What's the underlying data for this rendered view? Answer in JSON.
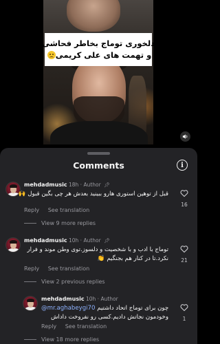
{
  "video": {
    "caption_line1": "دلخوری توماج بخاطر فحاشی",
    "caption_line2": "و تهمت های علی کریمی",
    "volume_icon": "speaker-icon"
  },
  "sheet": {
    "title": "Comments",
    "info_icon": "info-icon"
  },
  "comments": [
    {
      "username": "mehdadmusic",
      "time": "18h",
      "role": "Author",
      "text": "قبل از توهین استوری هارو ببینید بعدش هر چی بگین قبول 🙌",
      "reply_label": "Reply",
      "see_translation_label": "See translation",
      "likes": "16",
      "replies_label": "View 9 more replies"
    },
    {
      "username": "mehdadmusic",
      "time": "10h",
      "role": "Author",
      "text_line1": "توماج با ادب و با شخصیت و دلسوز.توی وطن موند و فرار",
      "text_line2": "نکرد.تا در کنار هم بجنگیم 👏",
      "reply_label": "Reply",
      "see_translation_label": "See translation",
      "likes": "21",
      "replies_label": "View 2 previous replies"
    },
    {
      "username": "mehdadmusic",
      "time": "10h",
      "role": "Author",
      "mention": "@mr.aghabeygi70",
      "text_line1": "چون برای توماج اتحاد داشتیم",
      "text_line2": "وخودمون نجاتش دادیم.کسی رو نفروخت داداش",
      "reply_label": "Reply",
      "see_translation_label": "See translation",
      "likes": "1",
      "replies_label": "View 18 more replies"
    }
  ]
}
